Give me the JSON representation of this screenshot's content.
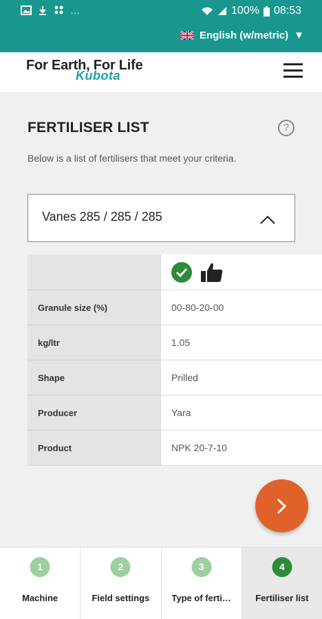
{
  "status_bar": {
    "left_indicators": "…",
    "battery": "100%",
    "time": "08:53"
  },
  "language": {
    "label": "English (w/metric)",
    "arrow": "▼"
  },
  "header": {
    "tagline": "For Earth, For Life",
    "logo": "Kubota"
  },
  "main": {
    "title": "FERTILISER LIST",
    "help": "?",
    "description": "Below is a list of fertilisers that meet your criteria.",
    "selector_label": "Vanes 285 / 285 / 285"
  },
  "table": {
    "rows": [
      {
        "label": "Granule size (%)",
        "value": "00-80-20-00"
      },
      {
        "label": "kg/ltr",
        "value": "1.05"
      },
      {
        "label": "Shape",
        "value": "Prilled"
      },
      {
        "label": "Producer",
        "value": "Yara"
      },
      {
        "label": "Product",
        "value": "NPK 20-7-10"
      }
    ]
  },
  "tabs": [
    {
      "num": "1",
      "label": "Machine"
    },
    {
      "num": "2",
      "label": "Field settings"
    },
    {
      "num": "3",
      "label": "Type of ferti…"
    },
    {
      "num": "4",
      "label": "Fertiliser list"
    }
  ],
  "colors": {
    "teal": "#19978f",
    "accent_orange": "#e1612a",
    "success_green": "#2e8b3a"
  }
}
